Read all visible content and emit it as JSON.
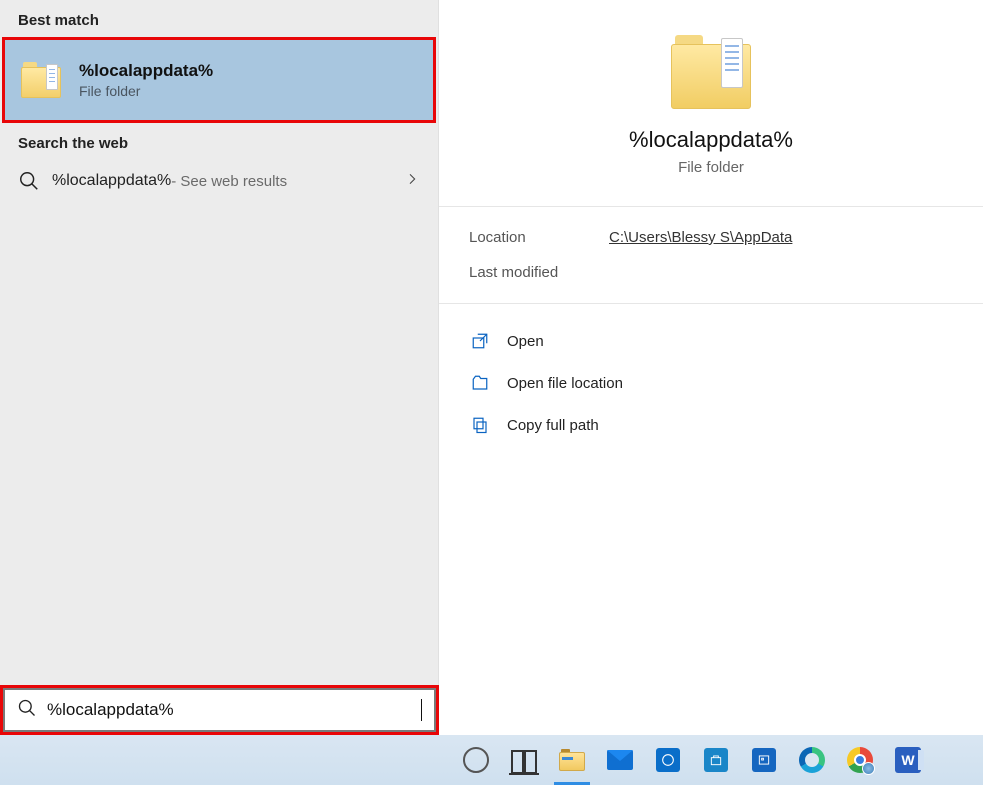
{
  "left": {
    "best_match_header": "Best match",
    "best_match": {
      "title": "%localappdata%",
      "subtitle": "File folder"
    },
    "web_header": "Search the web",
    "web_result": {
      "main": "%localappdata%",
      "suffix": " - See web results"
    }
  },
  "detail": {
    "title": "%localappdata%",
    "subtitle": "File folder",
    "location_label": "Location",
    "location_value": "C:\\Users\\Blessy S\\AppData",
    "last_modified_label": "Last modified",
    "last_modified_value": "",
    "actions": {
      "open": "Open",
      "open_location": "Open file location",
      "copy_path": "Copy full path"
    }
  },
  "search": {
    "value": "%localappdata%"
  },
  "taskbar": {
    "word_letter": "W"
  }
}
